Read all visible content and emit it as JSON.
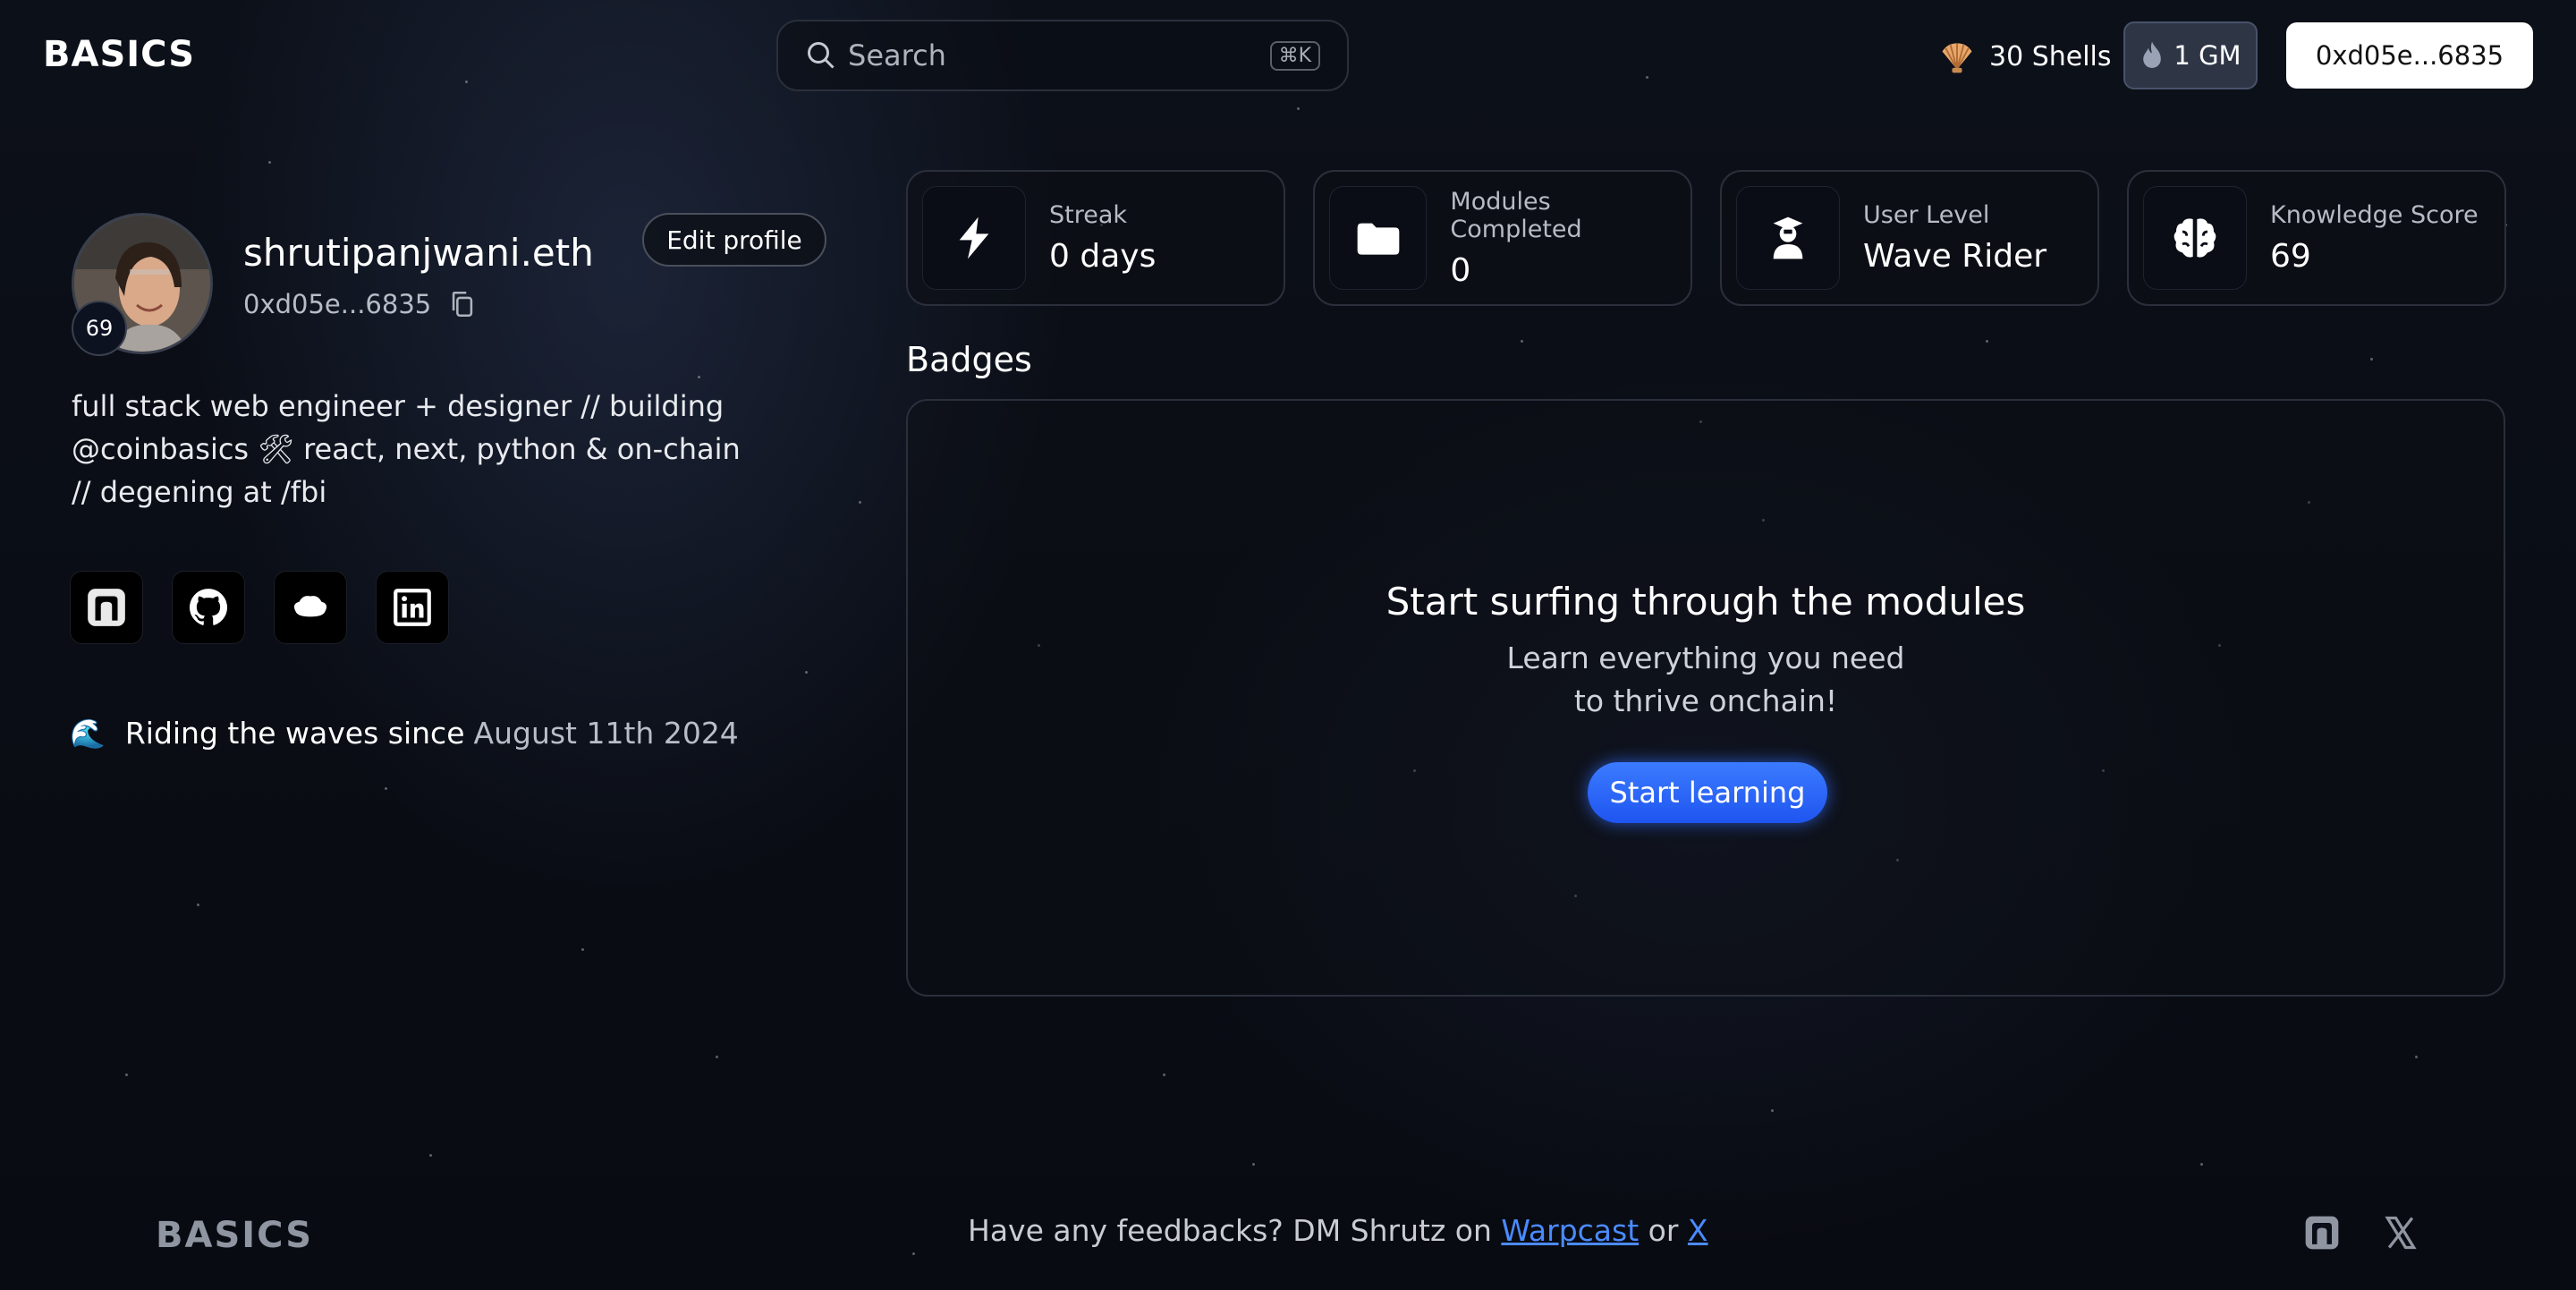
{
  "header": {
    "logo": "BASICS",
    "search": {
      "placeholder": "Search",
      "shortcut": "⌘K"
    },
    "shells": "30 Shells",
    "gm": "1 GM",
    "wallet": "0xd05e...6835"
  },
  "profile": {
    "level": "69",
    "username": "shrutipanjwani.eth",
    "address": "0xd05e...6835",
    "edit_label": "Edit profile",
    "bio": "full stack web engineer + designer // building @coinbasics 🛠 react, next, python & on-chain // degening at /fbi",
    "socials": [
      "farcaster",
      "github",
      "lens",
      "linkedin"
    ],
    "since_label": "Riding the waves since",
    "since_date": "August 11th 2024"
  },
  "stats": [
    {
      "label": "Streak",
      "value": "0 days",
      "icon": "lightning-icon"
    },
    {
      "label": "Modules Completed",
      "value": "0",
      "icon": "folder-icon"
    },
    {
      "label": "User Level",
      "value": "Wave Rider",
      "icon": "graduate-icon"
    },
    {
      "label": "Knowledge Score",
      "value": "69",
      "icon": "brain-icon"
    }
  ],
  "badges": {
    "title": "Badges",
    "empty_title": "Start surfing through the modules",
    "empty_sub_1": "Learn everything you need",
    "empty_sub_2": "to thrive onchain!",
    "cta": "Start learning"
  },
  "footer": {
    "logo": "BASICS",
    "feedback_prefix": "Have any feedbacks? DM Shrutz on",
    "warpcast": "Warpcast",
    "or": "or",
    "x": "X"
  },
  "colors": {
    "accent": "#2f6bff",
    "background": "#0b0e16",
    "card_border": "#2a2f3b"
  }
}
